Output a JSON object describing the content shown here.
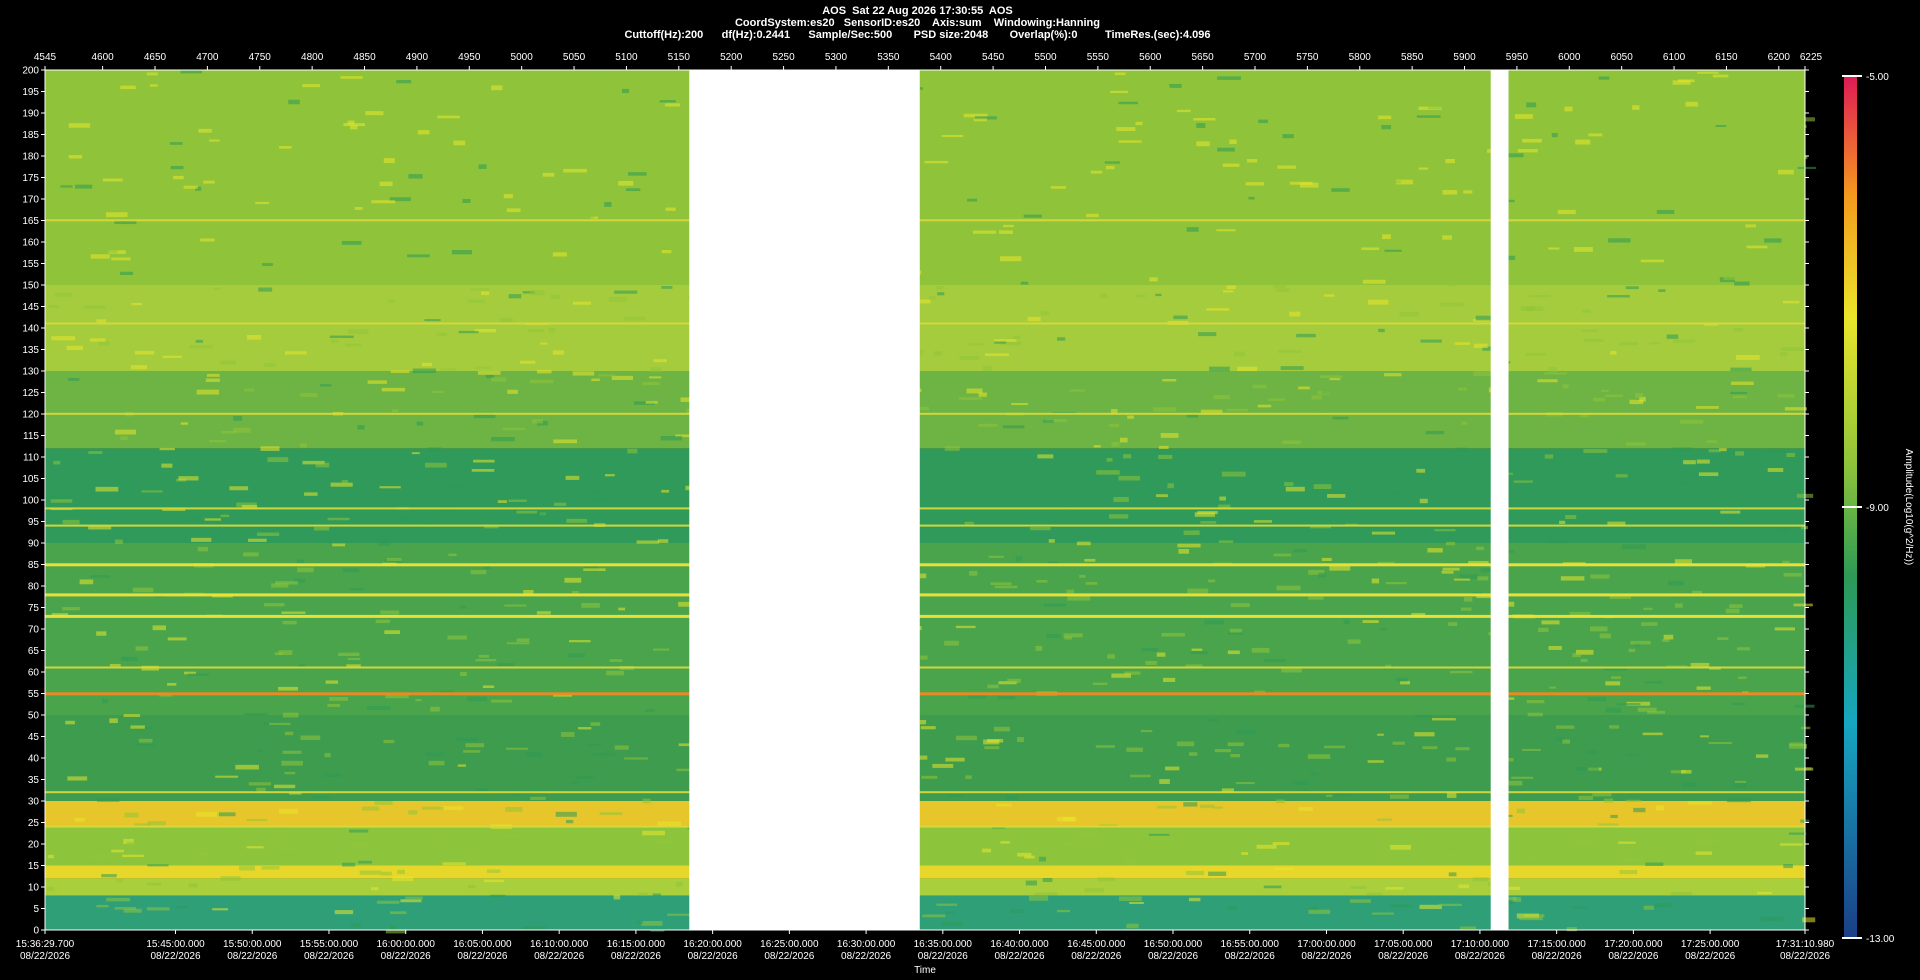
{
  "header": {
    "line1": "AOS  Sat 22 Aug 2026 17:30:55  AOS",
    "line2": "CoordSystem:es20   SensorID:es20    Axis:sum    Windowing:Hanning",
    "line3": "Cuttoff(Hz):200      df(Hz):0.2441      Sample/Sec:500       PSD size:2048       Overlap(%):0         TimeRes.(sec):4.096"
  },
  "colors": {
    "background": "#000000",
    "gap": "#ffffff",
    "colormap": [
      "#1b3f86",
      "#16a6c0",
      "#2d9a55",
      "#8fc43a",
      "#e9e62a",
      "#f59a1d",
      "#de1a55"
    ]
  },
  "chart_data": {
    "type": "heatmap",
    "title": "AOS  Sat 22 Aug 2026 17:30:55  AOS",
    "top_axis": {
      "ticks": [
        "4545",
        "4600",
        "4650",
        "4700",
        "4750",
        "4800",
        "4850",
        "4900",
        "4950",
        "5000",
        "5050",
        "5100",
        "5150",
        "5200",
        "5250",
        "5300",
        "5350",
        "5400",
        "5450",
        "5500",
        "5550",
        "5600",
        "5650",
        "5700",
        "5750",
        "5800",
        "5850",
        "5900",
        "5950",
        "6000",
        "6050",
        "6100",
        "6150",
        "6200",
        "6225"
      ],
      "range": [
        4545,
        6225
      ]
    },
    "ylabel": "",
    "ylim": [
      0,
      200
    ],
    "yticks": [
      "0",
      "5",
      "10",
      "15",
      "20",
      "25",
      "30",
      "35",
      "40",
      "45",
      "50",
      "55",
      "60",
      "65",
      "70",
      "75",
      "80",
      "85",
      "90",
      "95",
      "100",
      "105",
      "110",
      "115",
      "120",
      "125",
      "130",
      "135",
      "140",
      "145",
      "150",
      "155",
      "160",
      "165",
      "170",
      "175",
      "180",
      "185",
      "190",
      "195",
      "200"
    ],
    "xlabel": "Time",
    "xrange_seconds": [
      0,
      6881.28
    ],
    "xticks": [
      {
        "time": "15:36:29.700",
        "date": "08/22/2026"
      },
      {
        "time": "15:45:00.000",
        "date": "08/22/2026"
      },
      {
        "time": "15:50:00.000",
        "date": "08/22/2026"
      },
      {
        "time": "15:55:00.000",
        "date": "08/22/2026"
      },
      {
        "time": "16:00:00.000",
        "date": "08/22/2026"
      },
      {
        "time": "16:05:00.000",
        "date": "08/22/2026"
      },
      {
        "time": "16:10:00.000",
        "date": "08/22/2026"
      },
      {
        "time": "16:15:00.000",
        "date": "08/22/2026"
      },
      {
        "time": "16:20:00.000",
        "date": "08/22/2026"
      },
      {
        "time": "16:25:00.000",
        "date": "08/22/2026"
      },
      {
        "time": "16:30:00.000",
        "date": "08/22/2026"
      },
      {
        "time": "16:35:00.000",
        "date": "08/22/2026"
      },
      {
        "time": "16:40:00.000",
        "date": "08/22/2026"
      },
      {
        "time": "16:45:00.000",
        "date": "08/22/2026"
      },
      {
        "time": "16:50:00.000",
        "date": "08/22/2026"
      },
      {
        "time": "16:55:00.000",
        "date": "08/22/2026"
      },
      {
        "time": "17:00:00.000",
        "date": "08/22/2026"
      },
      {
        "time": "17:05:00.000",
        "date": "08/22/2026"
      },
      {
        "time": "17:10:00.000",
        "date": "08/22/2026"
      },
      {
        "time": "17:15:00.000",
        "date": "08/22/2026"
      },
      {
        "time": "17:20:00.000",
        "date": "08/22/2026"
      },
      {
        "time": "17:25:00.000",
        "date": "08/22/2026"
      },
      {
        "time": "17:31:10.980",
        "date": "08/22/2026"
      }
    ],
    "gaps_top_axis": [
      [
        5160,
        5380
      ],
      [
        5925,
        5942
      ]
    ],
    "persistent_lines_hz": [
      {
        "hz": 165,
        "strength": 0.7
      },
      {
        "hz": 141,
        "strength": 0.55
      },
      {
        "hz": 120,
        "strength": 0.7
      },
      {
        "hz": 98,
        "strength": 0.55
      },
      {
        "hz": 94,
        "strength": 0.4
      },
      {
        "hz": 85,
        "strength": 0.8
      },
      {
        "hz": 78,
        "strength": 0.9
      },
      {
        "hz": 73,
        "strength": 0.85
      },
      {
        "hz": 61,
        "strength": 0.75
      },
      {
        "hz": 55,
        "strength": 1.0
      },
      {
        "hz": 32,
        "strength": 0.5
      },
      {
        "hz": 24,
        "strength": 0.5
      }
    ],
    "colorbar": {
      "max": -5.0,
      "mid": -9.0,
      "min": -13.0,
      "max_label": "-5.00",
      "mid_label": "-9.00",
      "min_label": "-13.00",
      "label": "Amplitude(Log10(g^2/Hz))"
    }
  }
}
